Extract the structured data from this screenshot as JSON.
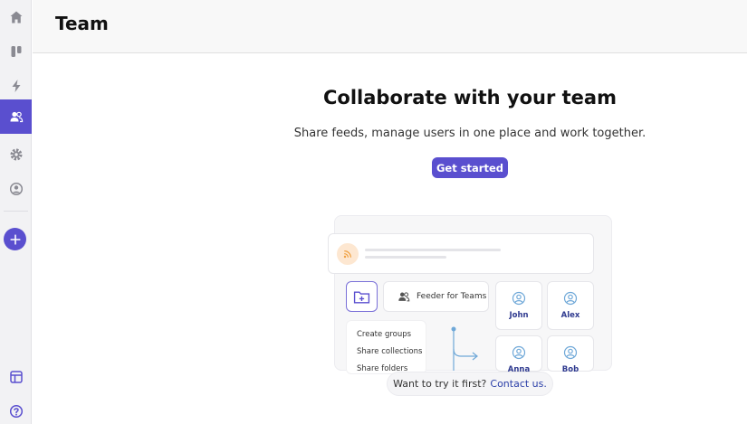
{
  "header": {
    "title": "Team"
  },
  "sidebar": {
    "items": [
      {
        "icon": "home-icon"
      },
      {
        "icon": "board-icon"
      },
      {
        "icon": "lightning-icon"
      },
      {
        "icon": "team-icon",
        "active": true
      },
      {
        "icon": "gear-icon"
      },
      {
        "icon": "account-icon"
      }
    ],
    "add_icon": "plus-icon",
    "bottom": [
      {
        "icon": "layout-icon"
      },
      {
        "icon": "help-icon"
      }
    ]
  },
  "hero": {
    "title": "Collaborate with your team",
    "subtitle": "Share feeds, manage users in one place and work together.",
    "cta_label": "Get started"
  },
  "illustration": {
    "feeder_label": "Feeder for Teams",
    "actions": [
      "Create groups",
      "Share collections",
      "Share folders"
    ],
    "users": [
      "John",
      "Alex",
      "Anna",
      "Bob"
    ]
  },
  "try": {
    "text": "Want to try it first?",
    "link": "Contact us."
  },
  "colors": {
    "accent": "#5a4fcf",
    "link": "#2b3fa8",
    "rss": "#f0a040"
  }
}
